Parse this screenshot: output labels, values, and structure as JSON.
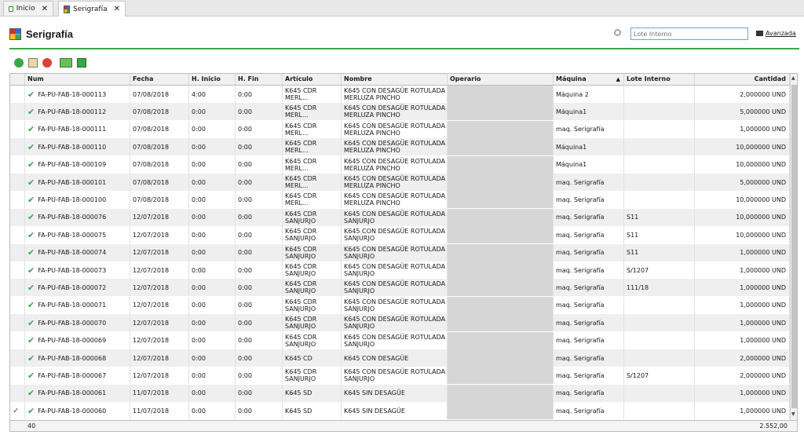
{
  "tabs": [
    {
      "label": "Inicio",
      "icon": "home-icon"
    },
    {
      "label": "Serigrafía",
      "icon": "serigrafia-icon"
    }
  ],
  "page": {
    "title": "Serigrafía"
  },
  "search": {
    "placeholder": "Lote Interno",
    "advanced_label": "Avanzada"
  },
  "toolbar": [
    "add-icon",
    "edit-icon",
    "delete-icon",
    "view-icon",
    "export-icon"
  ],
  "columns": [
    "Num",
    "Fecha",
    "H. Inicio",
    "H. Fin",
    "Artículo",
    "Nombre",
    "Operario",
    "Máquina",
    "Lote Interno",
    "Cantidad"
  ],
  "rows": [
    {
      "num": "FA-PU-FAB-18-000113",
      "fecha": "07/08/2018",
      "hini": "4:00",
      "hfin": "0:00",
      "articulo": "K645 CDR MERL...",
      "nombre": "K645 CON DESAGÜE ROTULADA MERLUZA PINCHO",
      "operario": "",
      "maquina": "Máquina 2",
      "lote": "",
      "cantidad": "2,000000 UND"
    },
    {
      "num": "FA-PU-FAB-18-000112",
      "fecha": "07/08/2018",
      "hini": "0:00",
      "hfin": "0:00",
      "articulo": "K645 CDR MERL...",
      "nombre": "K645 CON DESAGÜE ROTULADA MERLUZA PINCHO",
      "operario": "",
      "maquina": "Máquina1",
      "lote": "",
      "cantidad": "5,000000 UND"
    },
    {
      "num": "FA-PU-FAB-18-000111",
      "fecha": "07/08/2018",
      "hini": "0:00",
      "hfin": "0:00",
      "articulo": "K645 CDR MERL...",
      "nombre": "K645 CON DESAGÜE ROTULADA MERLUZA PINCHO",
      "operario": "",
      "maquina": "maq. Serigrafía",
      "lote": "",
      "cantidad": "1,000000 UND"
    },
    {
      "num": "FA-PU-FAB-18-000110",
      "fecha": "07/08/2018",
      "hini": "0:00",
      "hfin": "0:00",
      "articulo": "K645 CDR MERL...",
      "nombre": "K645 CON DESAGÜE ROTULADA MERLUZA PINCHO",
      "operario": "",
      "maquina": "Máquina1",
      "lote": "",
      "cantidad": "10,000000 UND"
    },
    {
      "num": "FA-PU-FAB-18-000109",
      "fecha": "07/08/2018",
      "hini": "0:00",
      "hfin": "0:00",
      "articulo": "K645 CDR MERL...",
      "nombre": "K645 CON DESAGÜE ROTULADA MERLUZA PINCHO",
      "operario": "",
      "maquina": "Máquina1",
      "lote": "",
      "cantidad": "10,000000 UND"
    },
    {
      "num": "FA-PU-FAB-18-000101",
      "fecha": "07/08/2018",
      "hini": "0:00",
      "hfin": "0:00",
      "articulo": "K645 CDR MERL...",
      "nombre": "K645 CON DESAGÜE ROTULADA MERLUZA PINCHO",
      "operario": "",
      "maquina": "maq. Serigrafía",
      "lote": "",
      "cantidad": "5,000000 UND"
    },
    {
      "num": "FA-PU-FAB-18-000100",
      "fecha": "07/08/2018",
      "hini": "0:00",
      "hfin": "0:00",
      "articulo": "K645 CDR MERL...",
      "nombre": "K645 CON DESAGÜE ROTULADA MERLUZA PINCHO",
      "operario": "",
      "maquina": "maq. Serigrafía",
      "lote": "",
      "cantidad": "10,000000 UND"
    },
    {
      "num": "FA-PU-FAB-18-000076",
      "fecha": "12/07/2018",
      "hini": "0:00",
      "hfin": "0:00",
      "articulo": "K645 CDR SANJURJO",
      "nombre": "K645 CON DESAGÜE ROTULADA SANJURJO",
      "operario": "",
      "maquina": "maq. Serigrafía",
      "lote": "S11",
      "cantidad": "10,000000 UND"
    },
    {
      "num": "FA-PU-FAB-18-000075",
      "fecha": "12/07/2018",
      "hini": "0:00",
      "hfin": "0:00",
      "articulo": "K645 CDR SANJURJO",
      "nombre": "K645 CON DESAGÜE ROTULADA SANJURJO",
      "operario": "",
      "maquina": "maq. Serigrafía",
      "lote": "S11",
      "cantidad": "10,000000 UND"
    },
    {
      "num": "FA-PU-FAB-18-000074",
      "fecha": "12/07/2018",
      "hini": "0:00",
      "hfin": "0:00",
      "articulo": "K645 CDR SANJURJO",
      "nombre": "K645 CON DESAGÜE ROTULADA SANJURJO",
      "operario": "",
      "maquina": "maq. Serigrafía",
      "lote": "S11",
      "cantidad": "1,000000 UND"
    },
    {
      "num": "FA-PU-FAB-18-000073",
      "fecha": "12/07/2018",
      "hini": "0:00",
      "hfin": "0:00",
      "articulo": "K645 CDR SANJURJO",
      "nombre": "K645 CON DESAGÜE ROTULADA SANJURJO",
      "operario": "",
      "maquina": "maq. Serigrafía",
      "lote": "S/1207",
      "cantidad": "1,000000 UND"
    },
    {
      "num": "FA-PU-FAB-18-000072",
      "fecha": "12/07/2018",
      "hini": "0:00",
      "hfin": "0:00",
      "articulo": "K645 CDR SANJURJO",
      "nombre": "K645 CON DESAGÜE ROTULADA SANJURJO",
      "operario": "",
      "maquina": "maq. Serigrafía",
      "lote": "111/18",
      "cantidad": "1,000000 UND"
    },
    {
      "num": "FA-PU-FAB-18-000071",
      "fecha": "12/07/2018",
      "hini": "0:00",
      "hfin": "0:00",
      "articulo": "K645 CDR SANJURJO",
      "nombre": "K645 CON DESAGÜE ROTULADA SANJURJO",
      "operario": "",
      "maquina": "maq. Serigrafía",
      "lote": "",
      "cantidad": "1,000000 UND"
    },
    {
      "num": "FA-PU-FAB-18-000070",
      "fecha": "12/07/2018",
      "hini": "0:00",
      "hfin": "0:00",
      "articulo": "K645 CDR SANJURJO",
      "nombre": "K645 CON DESAGÜE ROTULADA SANJURJO",
      "operario": "",
      "maquina": "maq. Serigrafía",
      "lote": "",
      "cantidad": "1,000000 UND"
    },
    {
      "num": "FA-PU-FAB-18-000069",
      "fecha": "12/07/2018",
      "hini": "0:00",
      "hfin": "0:00",
      "articulo": "K645 CDR SANJURJO",
      "nombre": "K645 CON DESAGÜE ROTULADA SANJURJO",
      "operario": "",
      "maquina": "maq. Serigrafía",
      "lote": "",
      "cantidad": "1,000000 UND"
    },
    {
      "num": "FA-PU-FAB-18-000068",
      "fecha": "12/07/2018",
      "hini": "0:00",
      "hfin": "0:00",
      "articulo": "K645 CD",
      "nombre": "K645 CON DESAGÜE",
      "operario": "",
      "maquina": "maq. Serigrafía",
      "lote": "",
      "cantidad": "2,000000 UND"
    },
    {
      "num": "FA-PU-FAB-18-000067",
      "fecha": "12/07/2018",
      "hini": "0:00",
      "hfin": "0:00",
      "articulo": "K645 CDR SANJURJO",
      "nombre": "K645 CON DESAGÜE ROTULADA SANJURJO",
      "operario": "",
      "maquina": "maq. Serigrafía",
      "lote": "S/1207",
      "cantidad": "2,000000 UND"
    },
    {
      "num": "FA-PU-FAB-18-000061",
      "fecha": "11/07/2018",
      "hini": "0:00",
      "hfin": "0:00",
      "articulo": "K645 SD",
      "nombre": "K645 SIN DESAGÜE",
      "operario": "",
      "maquina": "maq. Serigrafía",
      "lote": "",
      "cantidad": "1,000000 UND"
    },
    {
      "num": "FA-PU-FAB-18-000060",
      "fecha": "11/07/2018",
      "hini": "0:00",
      "hfin": "0:00",
      "articulo": "K645 SD",
      "nombre": "K645 SIN DESAGÜE",
      "operario": "",
      "maquina": "maq. Serigrafía",
      "lote": "",
      "cantidad": "1,000000 UND"
    }
  ],
  "selected_row": 18,
  "footer": {
    "count": "40",
    "total": "2.552,00"
  },
  "colors": {
    "accent": "#3aa648",
    "alt_row": "#efefef",
    "operario_bg": "#d6d6d6"
  }
}
